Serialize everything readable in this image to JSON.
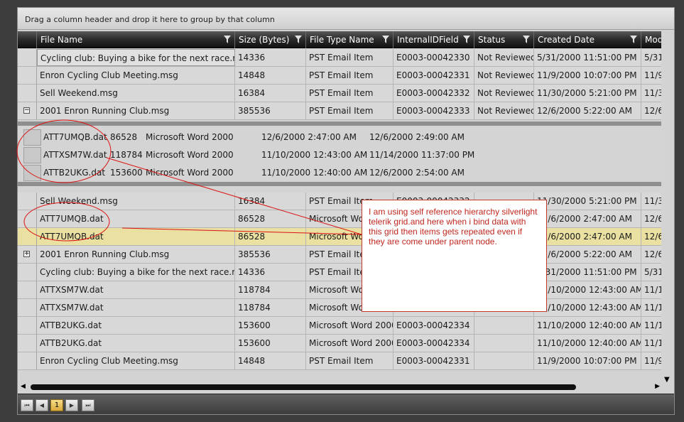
{
  "group_panel_text": "Drag a column header and drop it here to group by that column",
  "columns": [
    {
      "label": "File Name"
    },
    {
      "label": "Size (Bytes)"
    },
    {
      "label": "File Type Name"
    },
    {
      "label": "InternalIDField"
    },
    {
      "label": "Status"
    },
    {
      "label": "Created Date"
    },
    {
      "label": "Modi"
    }
  ],
  "rows_top": [
    {
      "name": "Cycling club: Buying a bike for the next race.msg",
      "size": "14336",
      "type": "PST Email Item",
      "id": "E0003-00042330",
      "status": "Not Reviewed",
      "created": "5/31/2000 11:51:00 PM",
      "mod": "5/31"
    },
    {
      "name": "Enron Cycling Club Meeting.msg",
      "size": "14848",
      "type": "PST Email Item",
      "id": "E0003-00042331",
      "status": "Not Reviewed",
      "created": "11/9/2000 10:07:00 PM",
      "mod": "11/9"
    },
    {
      "name": "Sell Weekend.msg",
      "size": "16384",
      "type": "PST Email Item",
      "id": "E0003-00042332",
      "status": "Not Reviewed",
      "created": "11/30/2000 5:21:00 PM",
      "mod": "11/3"
    },
    {
      "name": "2001 Enron Running Club.msg",
      "size": "385536",
      "type": "PST Email Item",
      "id": "E0003-00042333",
      "status": "Not Reviewed",
      "created": "12/6/2000 5:22:00 AM",
      "mod": "12/6",
      "expander": "−"
    }
  ],
  "detail_rows": [
    {
      "name": "ATT7UMQB.dat",
      "size": "86528",
      "type": "Microsoft Word 2000",
      "created": "12/6/2000 2:47:00 AM",
      "modified": "12/6/2000 2:49:00 AM"
    },
    {
      "name": "ATTXSM7W.dat",
      "size": "118784",
      "type": "Microsoft Word 2000",
      "created": "11/10/2000 12:43:00 AM",
      "modified": "11/14/2000 11:37:00 PM"
    },
    {
      "name": "ATTB2UKG.dat",
      "size": "153600",
      "type": "Microsoft Word 2000",
      "created": "11/10/2000 12:40:00 AM",
      "modified": "12/6/2000 2:54:00 AM"
    }
  ],
  "rows_bottom": [
    {
      "name": "Sell Weekend.msg",
      "size": "16384",
      "type": "PST Email Item",
      "id": "E0003-00042332",
      "status": "",
      "created": "11/30/2000 5:21:00 PM",
      "mod": "11/3"
    },
    {
      "name": "ATT7UMQB.dat",
      "size": "86528",
      "type": "Microsoft Word 2000",
      "id": "",
      "status": "",
      "created": "12/6/2000 2:47:00 AM",
      "mod": "12/6"
    },
    {
      "name": "ATT7UMQB.dat",
      "size": "86528",
      "type": "Microsoft Word 2000",
      "id": "",
      "status": "",
      "created": "12/6/2000 2:47:00 AM",
      "mod": "12/6"
    },
    {
      "name": "2001 Enron Running Club.msg",
      "size": "385536",
      "type": "PST Email Item",
      "id": "",
      "status": "",
      "created": "12/6/2000 5:22:00 AM",
      "mod": "12/6",
      "expander": "+"
    },
    {
      "name": "Cycling club: Buying a bike for the next race.msg",
      "size": "14336",
      "type": "PST Email Item",
      "id": "",
      "status": "",
      "created": "5/31/2000 11:51:00 PM",
      "mod": "5/31"
    },
    {
      "name": "ATTXSM7W.dat",
      "size": "118784",
      "type": "Microsoft Word 2000",
      "id": "",
      "status": "",
      "created": "11/10/2000 12:43:00 AM",
      "mod": "11/1"
    },
    {
      "name": "ATTXSM7W.dat",
      "size": "118784",
      "type": "Microsoft Word 2000",
      "id": "",
      "status": "",
      "created": "11/10/2000 12:43:00 AM",
      "mod": "11/1"
    },
    {
      "name": "ATTB2UKG.dat",
      "size": "153600",
      "type": "Microsoft Word 2000",
      "id": "E0003-00042334",
      "status": "",
      "created": "11/10/2000 12:40:00 AM",
      "mod": "11/1"
    },
    {
      "name": "ATTB2UKG.dat",
      "size": "153600",
      "type": "Microsoft Word 2000",
      "id": "E0003-00042334",
      "status": "",
      "created": "11/10/2000 12:40:00 AM",
      "mod": "11/1"
    },
    {
      "name": "Enron Cycling Club Meeting.msg",
      "size": "14848",
      "type": "PST Email Item",
      "id": "E0003-00042331",
      "status": "",
      "created": "11/9/2000 10:07:00 PM",
      "mod": "11/9"
    }
  ],
  "selected_bottom_index": 2,
  "annotation_text": "I am using self reference hierarchy silverlight telerik grid.and here when i bind data with this grid then items gets repeated even if they are come under parent node.",
  "pager": {
    "first": "⏮",
    "prev": "◀",
    "current": "1",
    "next": "▶",
    "last": "⏭"
  },
  "scroll": {
    "up": "▲",
    "down": "▼",
    "left": "◀",
    "right": "▶"
  },
  "colors": {
    "selected_row": "#e9e0a2",
    "annotation": "#c0271f"
  }
}
